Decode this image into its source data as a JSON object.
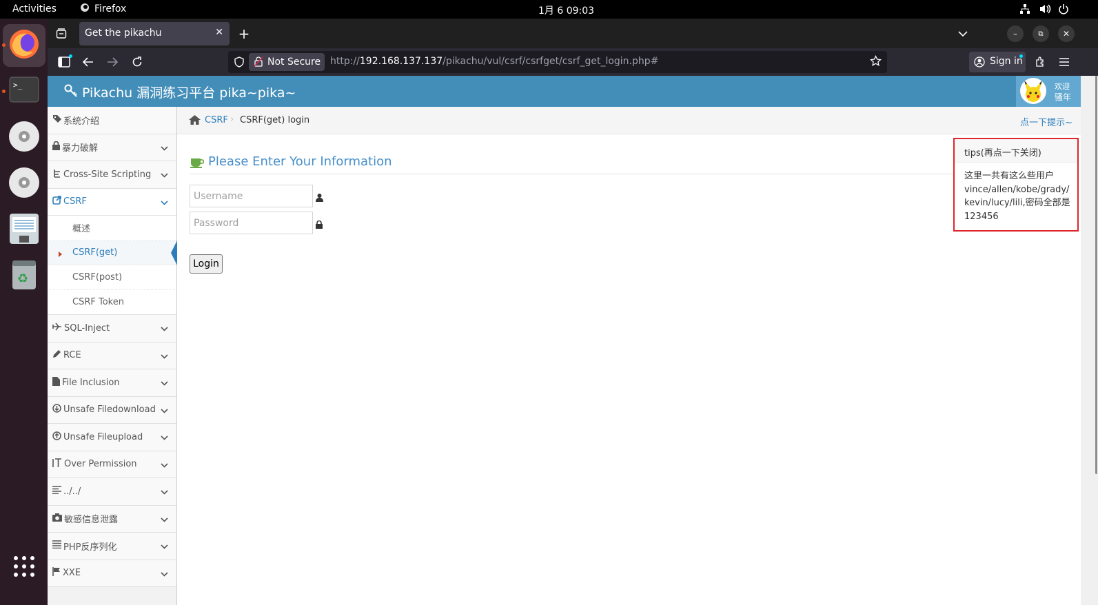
{
  "system": {
    "activities": "Activities",
    "app": "Firefox",
    "clock": "1月 6  09:03"
  },
  "browser": {
    "tab_title": "Get the pikachu",
    "not_secure": "Not Secure",
    "url_scheme": "http://",
    "url_host": "192.168.137.137",
    "url_path": "/pikachu/vul/csrf/csrfget/csrf_get_login.php#",
    "sign_in": "Sign in"
  },
  "app": {
    "title": "Pikachu 漏洞练习平台 pika~pika~",
    "welcome_1": "欢迎",
    "welcome_2": "骚年"
  },
  "sidebar": {
    "items": [
      {
        "label": "系统介绍",
        "icon": "tags-icon"
      },
      {
        "label": "暴力破解",
        "icon": "lock-icon"
      },
      {
        "label": "Cross-Site Scripting",
        "icon": "sitemap-icon"
      },
      {
        "label": "CSRF",
        "icon": "share-icon"
      },
      {
        "label": "SQL-Inject",
        "icon": "fighter-jet-icon"
      },
      {
        "label": "RCE",
        "icon": "pencil-icon"
      },
      {
        "label": "File Inclusion",
        "icon": "file-icon"
      },
      {
        "label": "Unsafe Filedownload",
        "icon": "download-icon"
      },
      {
        "label": "Unsafe Fileupload",
        "icon": "upload-icon"
      },
      {
        "label": "Over Permission",
        "icon": "text-cursor-icon"
      },
      {
        "label": "../../",
        "icon": "align-left-icon"
      },
      {
        "label": "敏感信息泄露",
        "icon": "camera-icon"
      },
      {
        "label": "PHP反序列化",
        "icon": "list-icon"
      },
      {
        "label": "XXE",
        "icon": "flag-icon"
      }
    ],
    "csrf_sub": [
      "概述",
      "CSRF(get)",
      "CSRF(post)",
      "CSRF Token"
    ]
  },
  "breadcrumb": {
    "parent": "CSRF",
    "current": "CSRF(get) login",
    "hint": "点一下提示~"
  },
  "form": {
    "heading": "Please Enter Your Information",
    "username_placeholder": "Username",
    "password_placeholder": "Password",
    "login_label": "Login"
  },
  "tips": {
    "title": "tips(再点一下关闭)",
    "line1": "这里一共有这么些用户",
    "line2": "vince/allen/kobe/grady/",
    "line3": "kevin/lucy/lili,密码全部是",
    "line4": "123456"
  },
  "colors": {
    "header": "#438eb9",
    "accent": "#2b7dbc",
    "tips_border": "#e0242c",
    "dock": "#2b1b24"
  }
}
